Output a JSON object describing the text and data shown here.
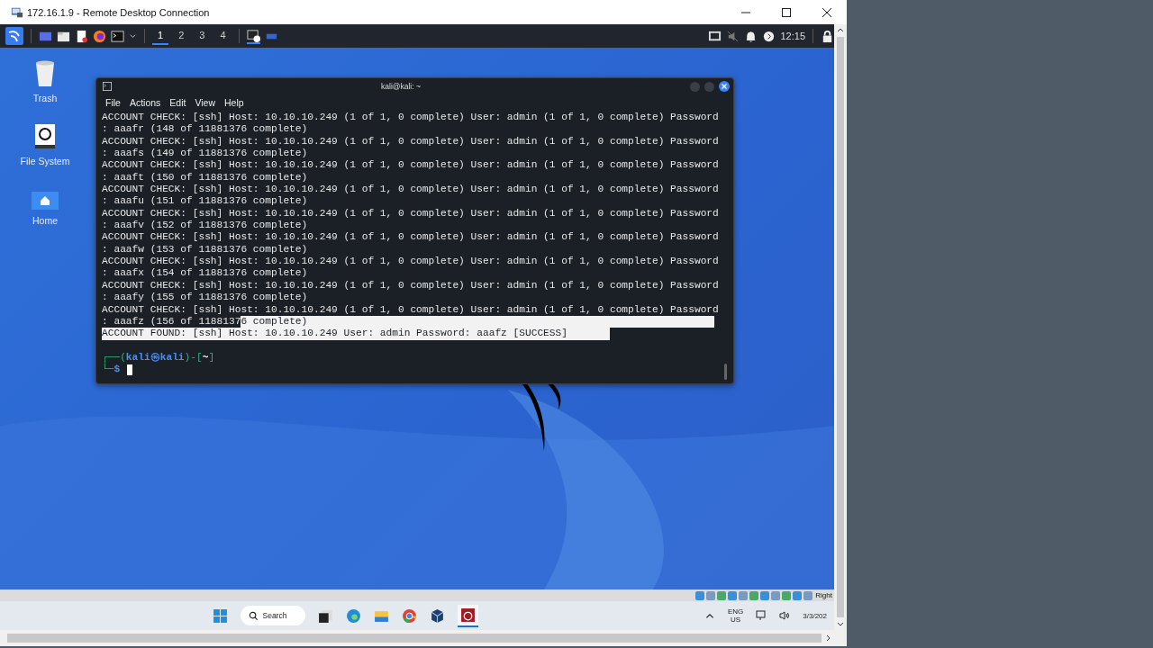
{
  "window": {
    "title": "172.16.1.9 - Remote Desktop Connection"
  },
  "panel": {
    "workspaces": [
      {
        "label": "1",
        "selected": true
      },
      {
        "label": "2",
        "selected": false
      },
      {
        "label": "3",
        "selected": false
      },
      {
        "label": "4",
        "selected": false
      }
    ],
    "clock": "12:15"
  },
  "desktop_icons": [
    {
      "kind": "trash",
      "label": "Trash"
    },
    {
      "kind": "drive",
      "label": "File System"
    },
    {
      "kind": "home",
      "label": "Home"
    }
  ],
  "terminal": {
    "title": "kali@kali: ~",
    "menu": [
      "File",
      "Actions",
      "Edit",
      "View",
      "Help"
    ],
    "lines": [
      {
        "segments": [
          {
            "text": "ACCOUNT CHECK: [ssh] Host: 10.10.10.249 (1 of 1, 0 complete) User: admin (1 of 1, 0 complete) Password",
            "selected": false
          }
        ]
      },
      {
        "segments": [
          {
            "text": ": aaafr (148 of 11881376 complete)",
            "selected": false
          }
        ]
      },
      {
        "segments": [
          {
            "text": "ACCOUNT CHECK: [ssh] Host: 10.10.10.249 (1 of 1, 0 complete) User: admin (1 of 1, 0 complete) Password",
            "selected": false
          }
        ]
      },
      {
        "segments": [
          {
            "text": ": aaafs (149 of 11881376 complete)",
            "selected": false
          }
        ]
      },
      {
        "segments": [
          {
            "text": "ACCOUNT CHECK: [ssh] Host: 10.10.10.249 (1 of 1, 0 complete) User: admin (1 of 1, 0 complete) Password",
            "selected": false
          }
        ]
      },
      {
        "segments": [
          {
            "text": ": aaaft (150 of 11881376 complete)",
            "selected": false
          }
        ]
      },
      {
        "segments": [
          {
            "text": "ACCOUNT CHECK: [ssh] Host: 10.10.10.249 (1 of 1, 0 complete) User: admin (1 of 1, 0 complete) Password",
            "selected": false
          }
        ]
      },
      {
        "segments": [
          {
            "text": ": aaafu (151 of 11881376 complete)",
            "selected": false
          }
        ]
      },
      {
        "segments": [
          {
            "text": "ACCOUNT CHECK: [ssh] Host: 10.10.10.249 (1 of 1, 0 complete) User: admin (1 of 1, 0 complete) Password",
            "selected": false
          }
        ]
      },
      {
        "segments": [
          {
            "text": ": aaafv (152 of 11881376 complete)",
            "selected": false
          }
        ]
      },
      {
        "segments": [
          {
            "text": "ACCOUNT CHECK: [ssh] Host: 10.10.10.249 (1 of 1, 0 complete) User: admin (1 of 1, 0 complete) Password",
            "selected": false
          }
        ]
      },
      {
        "segments": [
          {
            "text": ": aaafw (153 of 11881376 complete)",
            "selected": false
          }
        ]
      },
      {
        "segments": [
          {
            "text": "ACCOUNT CHECK: [ssh] Host: 10.10.10.249 (1 of 1, 0 complete) User: admin (1 of 1, 0 complete) Password",
            "selected": false
          }
        ]
      },
      {
        "segments": [
          {
            "text": ": aaafx (154 of 11881376 complete)",
            "selected": false
          }
        ]
      },
      {
        "segments": [
          {
            "text": "ACCOUNT CHECK: [ssh] Host: 10.10.10.249 (1 of 1, 0 complete) User: admin (1 of 1, 0 complete) Password",
            "selected": false
          }
        ]
      },
      {
        "segments": [
          {
            "text": ": aaafy (155 of 11881376 complete)",
            "selected": false
          }
        ]
      },
      {
        "segments": [
          {
            "text": "ACCOUNT CHECK: [ssh] Host: 10.10.10.249 (1 of 1, 0 complete) User: admin (1 of 1, 0 complete) Password",
            "selected": false
          }
        ]
      },
      {
        "segments": [
          {
            "text": ": aaafz (156 of 1188137",
            "selected": false
          },
          {
            "text": "6 complete)",
            "selected": true
          }
        ],
        "selected_to_end": true
      },
      {
        "segments": [
          {
            "text": "ACCOUNT FOUND: [ssh] Host: 10.10.10.249 User: admin Password: aaafz [SUCCESS]",
            "selected": true
          }
        ],
        "selected_to_end": false
      }
    ],
    "prompt": {
      "line1": [
        {
          "text": "┌──(",
          "kind": "frame"
        },
        {
          "text": "kali㉿kali",
          "kind": "user"
        },
        {
          "text": ")-[",
          "kind": "frame"
        },
        {
          "text": "~",
          "kind": "dir"
        },
        {
          "text": "]",
          "kind": "frame"
        }
      ],
      "line2": [
        {
          "text": "└─",
          "kind": "frame"
        },
        {
          "text": "$",
          "kind": "user"
        }
      ]
    }
  },
  "taskbar": {
    "search": {
      "placeholder": "Search"
    },
    "language": "ENG",
    "region": "US",
    "date": "3/3/202"
  },
  "vbox_status": {
    "host_key": "Right"
  }
}
